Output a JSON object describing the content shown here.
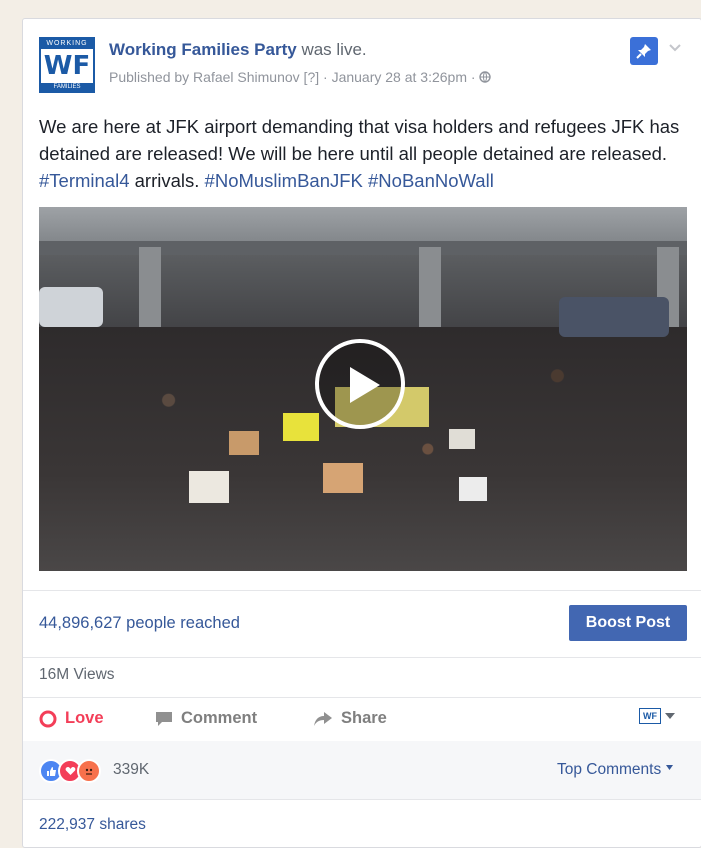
{
  "header": {
    "logo_top": "WORKING",
    "logo_mark": "WF",
    "logo_bottom": "FAMILIES",
    "page_name": "Working Families Party",
    "status": "was live.",
    "published_by": "Published by Rafael Shimunov [?] · January 28 at 3:26pm · ",
    "pin_icon": "pin-icon",
    "chevron_icon": "chevron-down-icon",
    "globe_icon": "globe-icon"
  },
  "post": {
    "text_before": "We are here at JFK airport demanding that visa holders and refugees JFK has detained are released! We will be here until all people detained are released. ",
    "tag1": "#Terminal4",
    "text_mid": " arrivals. ",
    "tag2": "#NoMuslimBanJFK",
    "tag3": "#NoBanNoWall"
  },
  "video": {
    "play_icon": "play-icon"
  },
  "stats": {
    "reached": "44,896,627 people reached",
    "boost_label": "Boost Post",
    "views": "16M Views"
  },
  "actions": {
    "love": "Love",
    "comment": "Comment",
    "share": "Share",
    "actor_mark": "WF"
  },
  "reactions": {
    "count": "339K",
    "top_comments": "Top Comments",
    "shares": "222,937 shares",
    "colors": {
      "like": "#4d86f2",
      "love": "#f33e58",
      "angry": "#f7714c"
    }
  }
}
